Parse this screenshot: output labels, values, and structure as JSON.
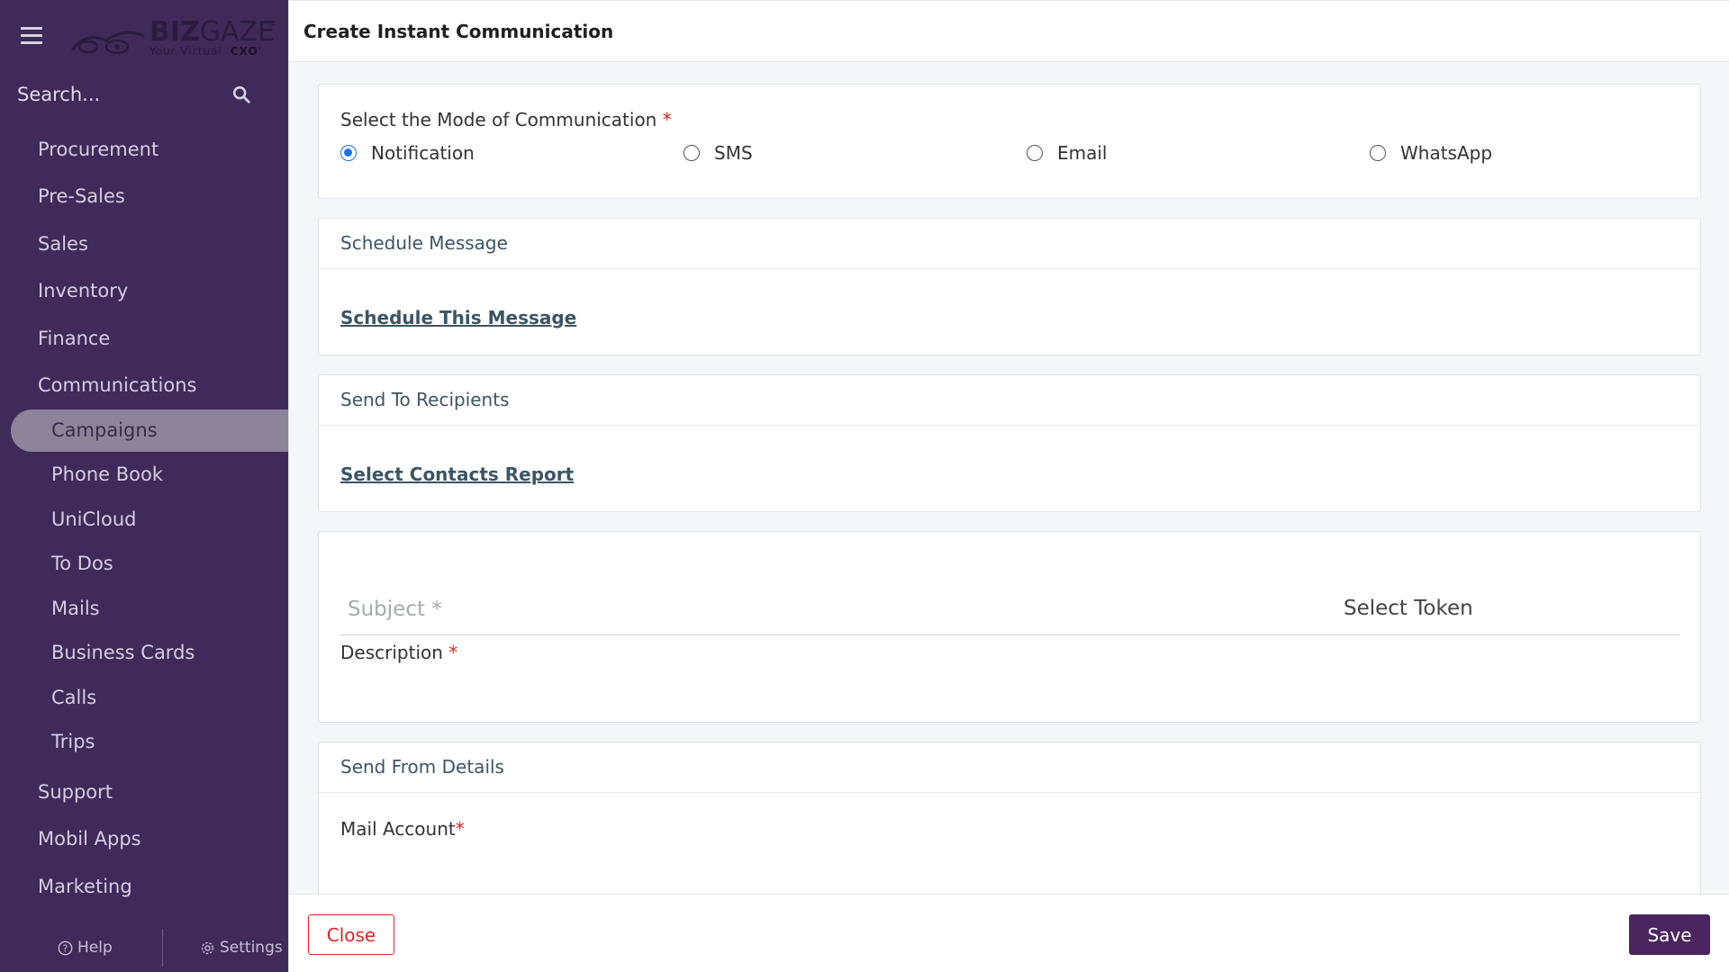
{
  "app": {
    "brand_bold": "BIZ",
    "brand_light": "GAZE",
    "tagline_prefix": "Your Virtual '",
    "tagline_bold": "CXO",
    "tagline_suffix": "'",
    "trademark": "TM"
  },
  "search": {
    "placeholder": "Search..."
  },
  "sidebar": {
    "items": [
      {
        "label": "Procurement"
      },
      {
        "label": "Pre-Sales"
      },
      {
        "label": "Sales"
      },
      {
        "label": "Inventory"
      },
      {
        "label": "Finance"
      },
      {
        "label": "Communications"
      }
    ],
    "sub_items": [
      {
        "label": "Campaigns",
        "active": true
      },
      {
        "label": "Phone Book"
      },
      {
        "label": "UniCloud"
      },
      {
        "label": "To Dos"
      },
      {
        "label": "Mails"
      },
      {
        "label": "Business Cards"
      },
      {
        "label": "Calls"
      },
      {
        "label": "Trips"
      }
    ],
    "bottom_items": [
      {
        "label": "Support"
      },
      {
        "label": "Mobil Apps"
      },
      {
        "label": "Marketing"
      }
    ],
    "footer": {
      "help": "Help",
      "settings": "Settings"
    }
  },
  "page": {
    "title": "Create Instant Communication"
  },
  "mode": {
    "label": "Select the Mode of Communication",
    "required_mark": "*",
    "options": [
      "Notification",
      "SMS",
      "Email",
      "WhatsApp"
    ],
    "selected": "Notification"
  },
  "schedule": {
    "heading": "Schedule Message",
    "link": "Schedule This Message"
  },
  "recipients": {
    "heading": "Send To Recipients",
    "link": "Select Contacts Report"
  },
  "message": {
    "subject_placeholder": "Subject *",
    "select_token": "Select Token",
    "description_label": "Description",
    "required_mark": "*"
  },
  "send_from": {
    "heading": "Send From Details",
    "mail_account_label": "Mail Account",
    "required_mark": "*"
  },
  "actions": {
    "close": "Close",
    "save": "Save"
  },
  "colors": {
    "sidebar_bg": "#3f2a59",
    "active_pill": "#8e8499",
    "accent": "#4a245e",
    "danger": "#e02424",
    "link": "#3c5565",
    "radio_selected": "#1a73e8"
  }
}
